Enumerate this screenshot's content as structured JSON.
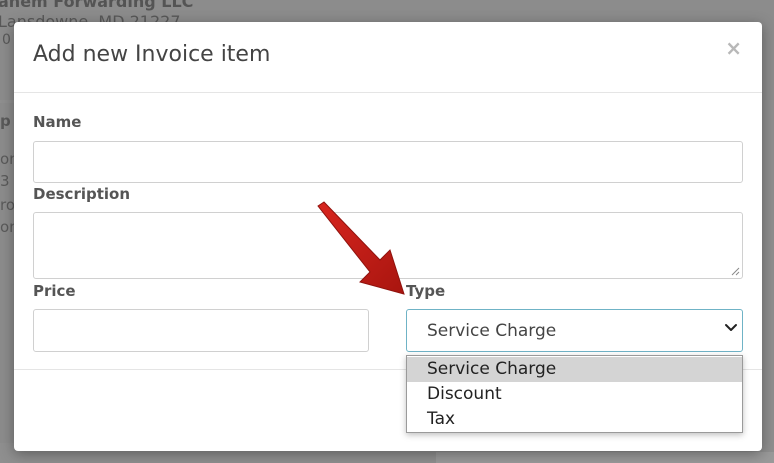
{
  "background": {
    "company_line": "anem Forwarding LLC",
    "address_line": "Lansdowne, MD 21227",
    "small_line": "0",
    "side_letters": [
      "p",
      "on",
      "3",
      "ro",
      "on"
    ]
  },
  "modal": {
    "title": "Add new Invoice item",
    "close_glyph": "×",
    "fields": {
      "name_label": "Name",
      "name_value": "",
      "description_label": "Description",
      "description_value": "",
      "price_label": "Price",
      "price_value": "",
      "type_label": "Type",
      "type_value": "Service Charge"
    }
  },
  "type_dropdown": {
    "options": [
      "Service Charge",
      "Discount",
      "Tax"
    ],
    "highlighted": "Service Charge"
  },
  "annotation": {
    "arrow_color": "#c0201c",
    "icon": "red-pointer-arrow"
  },
  "colors": {
    "select_border": "#6fb3c6",
    "highlight": "#d4d4d4",
    "overlay": "#8f8f8f"
  }
}
